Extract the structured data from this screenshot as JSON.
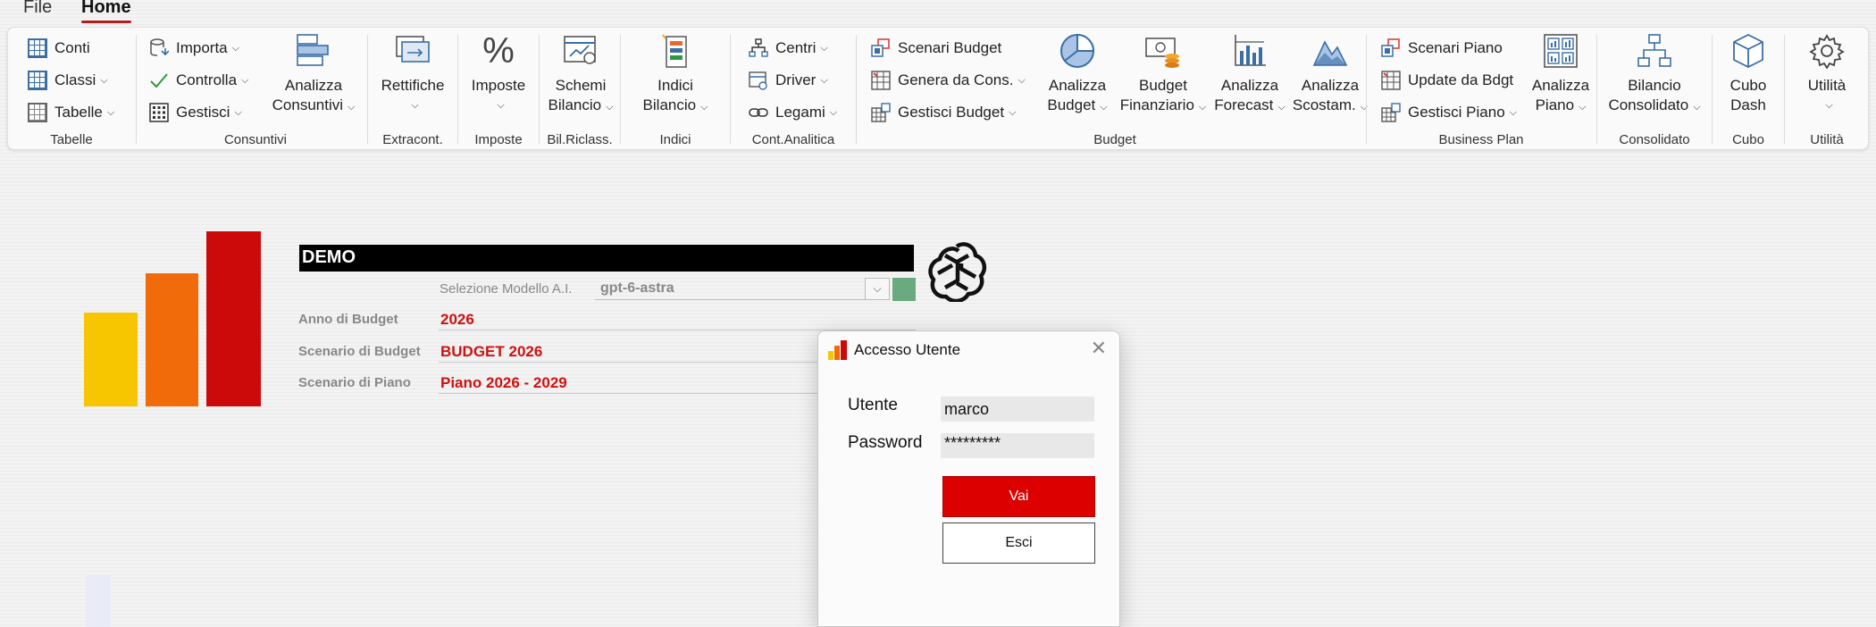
{
  "menu": {
    "file": "File",
    "home": "Home"
  },
  "ribbon": {
    "tabelle": {
      "conti": "Conti",
      "classi": "Classi",
      "tabelle": "Tabelle",
      "label": "Tabelle"
    },
    "consuntivi": {
      "importa": "Importa",
      "controlla": "Controlla",
      "gestisci": "Gestisci",
      "analizza_l1": "Analizza",
      "analizza_l2": "Consuntivi",
      "label": "Consuntivi"
    },
    "extracont": {
      "btn_l1": "Rettifiche",
      "label": "Extracont."
    },
    "imposte": {
      "btn_l1": "Imposte",
      "label": "Imposte"
    },
    "bilriclass": {
      "btn_l1": "Schemi",
      "btn_l2": "Bilancio",
      "label": "Bil.Riclass."
    },
    "indici": {
      "btn_l1": "Indici",
      "btn_l2": "Bilancio",
      "label": "Indici"
    },
    "contanalitica": {
      "centri": "Centri",
      "driver": "Driver",
      "legami": "Legami",
      "label": "Cont.Analitica"
    },
    "budget": {
      "scenari": "Scenari Budget",
      "genera": "Genera da Cons.",
      "gestisci": "Gestisci Budget",
      "ab_l1": "Analizza",
      "ab_l2": "Budget",
      "bf_l1": "Budget",
      "bf_l2": "Finanziario",
      "af_l1": "Analizza",
      "af_l2": "Forecast",
      "as_l1": "Analizza",
      "as_l2": "Scostam.",
      "label": "Budget"
    },
    "bp": {
      "scenari": "Scenari Piano",
      "update": "Update da Bdgt",
      "gestisci": "Gestisci Piano",
      "ap_l1": "Analizza",
      "ap_l2": "Piano",
      "label": "Business Plan"
    },
    "consolidato": {
      "btn_l1": "Bilancio",
      "btn_l2": "Consolidato",
      "label": "Consolidato"
    },
    "cubo": {
      "btn_l1": "Cubo",
      "btn_l2": "Dash",
      "label": "Cubo"
    },
    "utilita": {
      "btn_l1": "Utilità",
      "label": "Utilità"
    }
  },
  "main": {
    "title": "DEMO",
    "model_label": "Selezione Modello A.I.",
    "model_value": "gpt-6-astra",
    "anno_label": "Anno di Budget",
    "anno_value": "2026",
    "scenario_budget_label": "Scenario di Budget",
    "scenario_budget_value": "BUDGET 2026",
    "scenario_piano_label": "Scenario di Piano",
    "scenario_piano_value": "Piano 2026 - 2029"
  },
  "dialog": {
    "title": "Accesso Utente",
    "utente_label": "Utente",
    "utente_value": "marco",
    "password_label": "Password",
    "password_value": "*********",
    "vai": "Vai",
    "esci": "Esci"
  },
  "colors": {
    "accent_red": "#dd0000",
    "logo_yellow": "#f7c600",
    "logo_orange": "#f26b0a",
    "logo_red": "#cc0a0a",
    "model_green": "#6aaa7e"
  }
}
